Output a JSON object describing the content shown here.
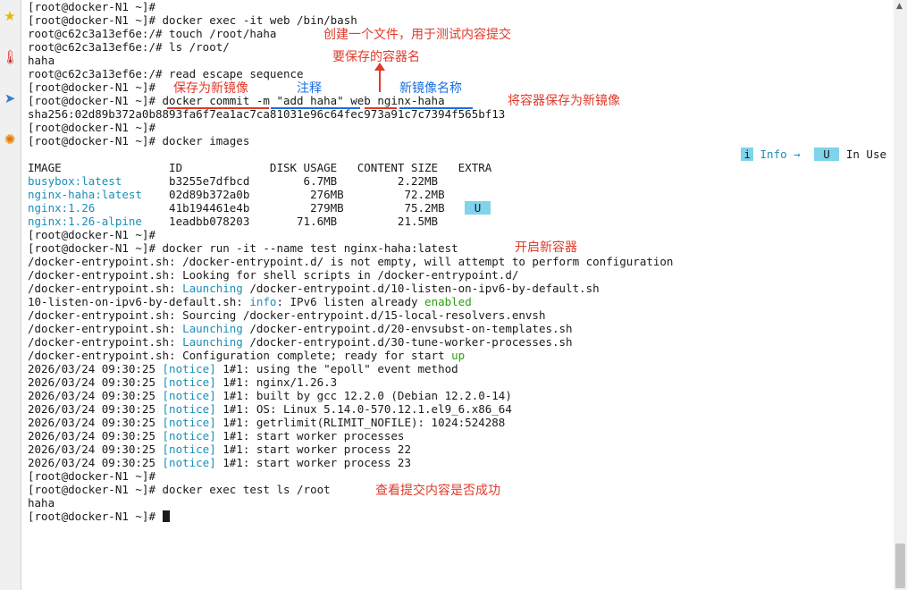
{
  "sidebar": {
    "icons": [
      {
        "name": "star-icon",
        "glyph": "★",
        "color": "#e8b800"
      },
      {
        "name": "thermometer-icon",
        "glyph": "🌡",
        "color": "#d03030"
      },
      {
        "name": "paper-plane-icon",
        "glyph": "➤",
        "color": "#3a7bd5"
      },
      {
        "name": "compass-icon",
        "glyph": "✺",
        "color": "#e07b00"
      }
    ]
  },
  "terminal": {
    "lines": [
      "[root@docker-N1 ~]#",
      "[root@docker-N1 ~]# docker exec -it web /bin/bash",
      "root@c62c3a13ef6e:/# touch /root/haha",
      "root@c62c3a13ef6e:/# ls /root/",
      "haha",
      "root@c62c3a13ef6e:/# read escape sequence",
      "[root@docker-N1 ~]#",
      "[root@docker-N1 ~]# docker commit -m \"add haha\" web nginx-haha",
      "sha256:02d89b372a0b8893fa6f7ea1ac7ca81031e96c64fec973a91c7c7394f565bf13",
      "[root@docker-N1 ~]#",
      "[root@docker-N1 ~]# docker images",
      {
        "right": true,
        "info": "i",
        "info_text": "Info →",
        "u": "U",
        "u_text": "In Use"
      },
      "IMAGE                ID             DISK USAGE   CONTENT SIZE   EXTRA",
      {
        "cyan": "busybox:latest      ",
        "rest": " b3255e7dfbcd        6.7MB         2.22MB"
      },
      {
        "cyan": "nginx-haha:latest   ",
        "rest": " 02d89b372a0b         276MB         72.2MB"
      },
      {
        "cyan": "nginx:1.26          ",
        "rest": " 41b194461e4b         279MB         75.2MB   ",
        "badge": "U"
      },
      {
        "cyan": "nginx:1.26-alpine   ",
        "rest": " 1eadbb078203       71.6MB         21.5MB"
      },
      "[root@docker-N1 ~]#",
      "[root@docker-N1 ~]# docker run -it --name test nginx-haha:latest",
      "/docker-entrypoint.sh: /docker-entrypoint.d/ is not empty, will attempt to perform configuration",
      "/docker-entrypoint.sh: Looking for shell scripts in /docker-entrypoint.d/",
      {
        "pre": "/docker-entrypoint.sh: ",
        "cyan": "Launching",
        "rest": " /docker-entrypoint.d/10-listen-on-ipv6-by-default.sh"
      },
      {
        "pre": "10-listen-on-ipv6-by-default.sh: ",
        "cyan": "info",
        "rest": ": IPv6 listen already ",
        "green": "enabled"
      },
      "/docker-entrypoint.sh: Sourcing /docker-entrypoint.d/15-local-resolvers.envsh",
      {
        "pre": "/docker-entrypoint.sh: ",
        "cyan": "Launching",
        "rest": " /docker-entrypoint.d/20-envsubst-on-templates.sh"
      },
      {
        "pre": "/docker-entrypoint.sh: ",
        "cyan": "Launching",
        "rest": " /docker-entrypoint.d/30-tune-worker-processes.sh"
      },
      {
        "pre": "/docker-entrypoint.sh: Configuration complete; ready for start ",
        "green": "up"
      },
      {
        "pre": "2026/03/24 09:30:25 ",
        "cyan": "[notice]",
        "rest": " 1#1: using the \"epoll\" event method"
      },
      {
        "pre": "2026/03/24 09:30:25 ",
        "cyan": "[notice]",
        "rest": " 1#1: nginx/1.26.3"
      },
      {
        "pre": "2026/03/24 09:30:25 ",
        "cyan": "[notice]",
        "rest": " 1#1: built by gcc 12.2.0 (Debian 12.2.0-14)"
      },
      {
        "pre": "2026/03/24 09:30:25 ",
        "cyan": "[notice]",
        "rest": " 1#1: OS: Linux 5.14.0-570.12.1.el9_6.x86_64"
      },
      {
        "pre": "2026/03/24 09:30:25 ",
        "cyan": "[notice]",
        "rest": " 1#1: getrlimit(RLIMIT_NOFILE): 1024:524288"
      },
      {
        "pre": "2026/03/24 09:30:25 ",
        "cyan": "[notice]",
        "rest": " 1#1: start worker processes"
      },
      {
        "pre": "2026/03/24 09:30:25 ",
        "cyan": "[notice]",
        "rest": " 1#1: start worker process 22"
      },
      {
        "pre": "2026/03/24 09:30:25 ",
        "cyan": "[notice]",
        "rest": " 1#1: start worker process 23"
      },
      "[root@docker-N1 ~]#",
      "[root@docker-N1 ~]# docker exec test ls /root",
      "haha",
      {
        "pre": "[root@docker-N1 ~]# ",
        "cursor": true
      }
    ]
  },
  "annotations": {
    "create_file": "创建一个文件，用于测试内容提交",
    "container_name": "要保存的容器名",
    "save_as_image_label": "保存为新镜像",
    "comment_label": "注释",
    "new_image_name_label": "新镜像名称",
    "save_container": "将容器保存为新镜像",
    "start_container": "开启新容器",
    "check_commit": "查看提交内容是否成功"
  },
  "colors": {
    "cyan": "#1a8fb8",
    "green": "#2aa012",
    "annotation_red": "#e03a2a",
    "annotation_blue": "#1a70e0",
    "badge_bg": "#7fd3ea"
  }
}
